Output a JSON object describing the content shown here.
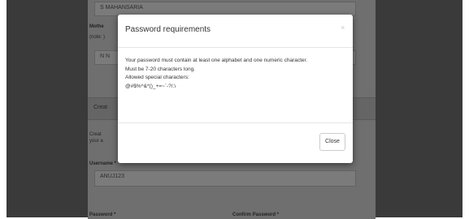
{
  "background_form": {
    "top_field_value": "S MAHANSARIA",
    "mother_label": "Mothe",
    "note_label": "(note: )",
    "second_field_value": "N N",
    "section_header": "Creat",
    "section_text_line1": "Creat",
    "section_text_line2": "your a",
    "username_label": "Username *",
    "username_value": "ANUJ123",
    "password_label": "Password *",
    "confirm_password_label": "Confirm Password *"
  },
  "modal": {
    "title": "Password requirements",
    "close_x": "×",
    "lines": [
      "Your password must contain at least one alphabet and one numeric character.",
      "Must be 7-20 characters long.",
      "Allowed special characters:",
      "@#$%^&*()_+=~`-?/.\\"
    ],
    "close_button_label": "Close"
  },
  "colors": {
    "backdrop": "#3a3a3a",
    "page_dimmed": "#6f6f6f",
    "modal_background": "#ffffff",
    "modal_title_text": "#333333"
  }
}
